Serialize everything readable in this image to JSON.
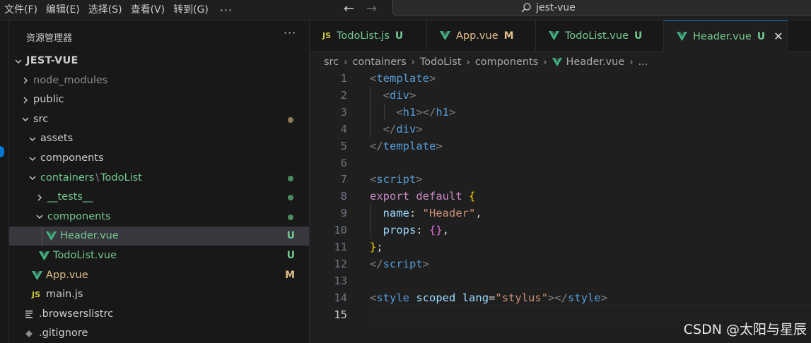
{
  "menu": {
    "items": [
      "文件(F)",
      "编辑(E)",
      "选择(S)",
      "查看(V)",
      "转到(G)"
    ],
    "more": "···"
  },
  "command_center": {
    "query": "jest-vue"
  },
  "explorer": {
    "title": "资源管理器",
    "more": "···",
    "tree": [
      {
        "label": "JEST-VUE",
        "kind": "root",
        "chevron": "down",
        "color": "plain"
      },
      {
        "label": "node_modules",
        "kind": "folder",
        "chevron": "right",
        "color": "gray"
      },
      {
        "label": "public",
        "kind": "folder",
        "chevron": "right",
        "color": "plain"
      },
      {
        "label": "src",
        "kind": "folder",
        "chevron": "down",
        "color": "plain",
        "decoration": "dot-orange"
      },
      {
        "label": "assets",
        "kind": "folder",
        "chevron": "down",
        "color": "plain"
      },
      {
        "label": "components",
        "kind": "folder",
        "chevron": "down",
        "color": "plain"
      },
      {
        "label": "containers",
        "label2": "TodoList",
        "kind": "folder",
        "chevron": "down",
        "color": "green",
        "decoration": "dot-green"
      },
      {
        "label": "__tests__",
        "kind": "folder",
        "chevron": "right",
        "color": "green",
        "decoration": "dot-green"
      },
      {
        "label": "components",
        "kind": "folder",
        "chevron": "down",
        "color": "green",
        "decoration": "dot-green"
      },
      {
        "label": "Header.vue",
        "kind": "vue",
        "color": "green",
        "badge": "U",
        "selected": true
      },
      {
        "label": "TodoList.vue",
        "kind": "vue",
        "color": "green",
        "badge": "U"
      },
      {
        "label": "App.vue",
        "kind": "vue",
        "color": "orange",
        "badge": "M"
      },
      {
        "label": "main.js",
        "kind": "js",
        "color": "plain"
      },
      {
        "label": ".browserslistrc",
        "kind": "lines",
        "color": "plain"
      },
      {
        "label": ".gitignore",
        "kind": "git",
        "color": "plain"
      }
    ],
    "path_sep": "\\"
  },
  "tabs": [
    {
      "name": "TodoList.js",
      "status": "U",
      "icon": "js-icon",
      "color": "green"
    },
    {
      "name": "App.vue",
      "status": "M",
      "icon": "vue-icon",
      "color": "orange"
    },
    {
      "name": "TodoList.vue",
      "status": "U",
      "icon": "vue-icon",
      "color": "green"
    },
    {
      "name": "Header.vue",
      "status": "U",
      "icon": "vue-icon",
      "color": "green",
      "active": true,
      "close": "✕"
    }
  ],
  "breadcrumb": {
    "parts": [
      "src",
      "containers",
      "TodoList",
      "components"
    ],
    "file": "Header.vue",
    "tail": "...",
    "sep": "›"
  },
  "editor": {
    "current_line": 15,
    "lines": [
      [
        [
          "t-br",
          "<"
        ],
        [
          "t-tag",
          "template"
        ],
        [
          "t-br",
          ">"
        ]
      ],
      [
        [
          "t-p",
          "  "
        ],
        [
          "t-br",
          "<"
        ],
        [
          "t-tag",
          "div"
        ],
        [
          "t-br",
          ">"
        ]
      ],
      [
        [
          "t-p",
          "    "
        ],
        [
          "t-br",
          "<"
        ],
        [
          "t-tag",
          "h1"
        ],
        [
          "t-br",
          "></"
        ],
        [
          "t-tag",
          "h1"
        ],
        [
          "t-br",
          ">"
        ]
      ],
      [
        [
          "t-p",
          "  "
        ],
        [
          "t-br",
          "</"
        ],
        [
          "t-tag",
          "div"
        ],
        [
          "t-br",
          ">"
        ]
      ],
      [
        [
          "t-br",
          "</"
        ],
        [
          "t-tag",
          "template"
        ],
        [
          "t-br",
          ">"
        ]
      ],
      [],
      [
        [
          "t-br",
          "<"
        ],
        [
          "t-tag",
          "script"
        ],
        [
          "t-br",
          ">"
        ]
      ],
      [
        [
          "t-kw",
          "export"
        ],
        [
          "t-p",
          " "
        ],
        [
          "t-kw",
          "default"
        ],
        [
          "t-p",
          " "
        ],
        [
          "t-y",
          "{"
        ]
      ],
      [
        [
          "t-p",
          "  "
        ],
        [
          "t-prop",
          "name"
        ],
        [
          "t-p",
          ": "
        ],
        [
          "t-str",
          "\"Header\""
        ],
        [
          "t-p",
          ","
        ]
      ],
      [
        [
          "t-p",
          "  "
        ],
        [
          "t-prop",
          "props"
        ],
        [
          "t-p",
          ": "
        ],
        [
          "t-m",
          "{}"
        ],
        [
          "t-p",
          ","
        ]
      ],
      [
        [
          "t-y",
          "}"
        ],
        [
          "t-p",
          ";"
        ]
      ],
      [
        [
          "t-br",
          "</"
        ],
        [
          "t-tag",
          "script"
        ],
        [
          "t-br",
          ">"
        ]
      ],
      [],
      [
        [
          "t-br",
          "<"
        ],
        [
          "t-tag",
          "style"
        ],
        [
          "t-p",
          " "
        ],
        [
          "t-attr",
          "scoped"
        ],
        [
          "t-p",
          " "
        ],
        [
          "t-attr",
          "lang"
        ],
        [
          "t-p",
          "="
        ],
        [
          "t-str",
          "\"stylus\""
        ],
        [
          "t-br",
          "></"
        ],
        [
          "t-tag",
          "style"
        ],
        [
          "t-br",
          ">"
        ]
      ],
      []
    ]
  },
  "watermark": "CSDN @太阳与星辰",
  "colors": {
    "accent": "#0078d4",
    "untracked": "#73c991",
    "modified": "#e2c08d",
    "vue": "#42b883",
    "js": "#cbcb41"
  }
}
